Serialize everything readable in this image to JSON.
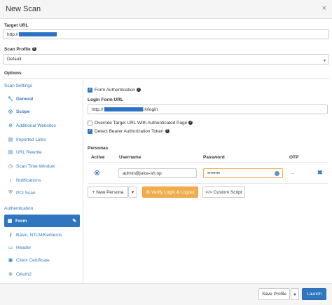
{
  "dialog": {
    "title": "New Scan",
    "close": "×"
  },
  "target_url": {
    "label": "Target URL",
    "value": "http://"
  },
  "scan_profile": {
    "label": "Scan Profile",
    "value": "Default"
  },
  "options": {
    "label": "Options"
  },
  "sidebar": {
    "scan_settings_title": "Scan Settings",
    "items": [
      {
        "label": "General",
        "icon": "wrench-icon"
      },
      {
        "label": "Scope",
        "icon": "target-icon"
      },
      {
        "label": "Additional Websites",
        "icon": "globe-icon"
      },
      {
        "label": "Imported Links",
        "icon": "file-icon"
      },
      {
        "label": "URL Rewrite",
        "icon": "file-icon"
      },
      {
        "label": "Scan Time Window",
        "icon": "clock-icon"
      },
      {
        "label": "Notifications",
        "icon": "bell-icon"
      },
      {
        "label": "PCI Scan",
        "icon": "shield-icon"
      }
    ],
    "authentication_title": "Authentication",
    "auth_items": [
      {
        "label": "Form",
        "icon": "form-icon"
      },
      {
        "label": "Basic, NTLM/Kerberos",
        "icon": "key-icon"
      },
      {
        "label": "Header",
        "icon": "header-icon"
      },
      {
        "label": "Client Certificate",
        "icon": "certificate-icon"
      },
      {
        "label": "OAuth2",
        "icon": "oauth-icon"
      }
    ]
  },
  "form_auth": {
    "enable_label": "Form Authentication",
    "login_url_label": "Login Form URL",
    "login_url_prefix": "http://",
    "login_url_suffix": "/#/login",
    "override_label": "Override Target URL With Authenticated Page",
    "bearer_label": "Detect Bearer Authorization Token"
  },
  "personas": {
    "title": "Personas",
    "columns": [
      "Active",
      "Username",
      "Password",
      "OTP"
    ],
    "rows": [
      {
        "username": "admin@juice-sh.op",
        "password": "••••••••",
        "otp": "..."
      }
    ],
    "new_persona": "+ New Persona",
    "verify": "Verify Login & Logout",
    "custom_script": "</> Custom Script"
  },
  "footer": {
    "save_profile": "Save Profile",
    "launch": "Launch"
  },
  "colors": {
    "accent": "#2f75c0",
    "warning": "#f0ad4e",
    "redaction": "#2a72c6"
  }
}
